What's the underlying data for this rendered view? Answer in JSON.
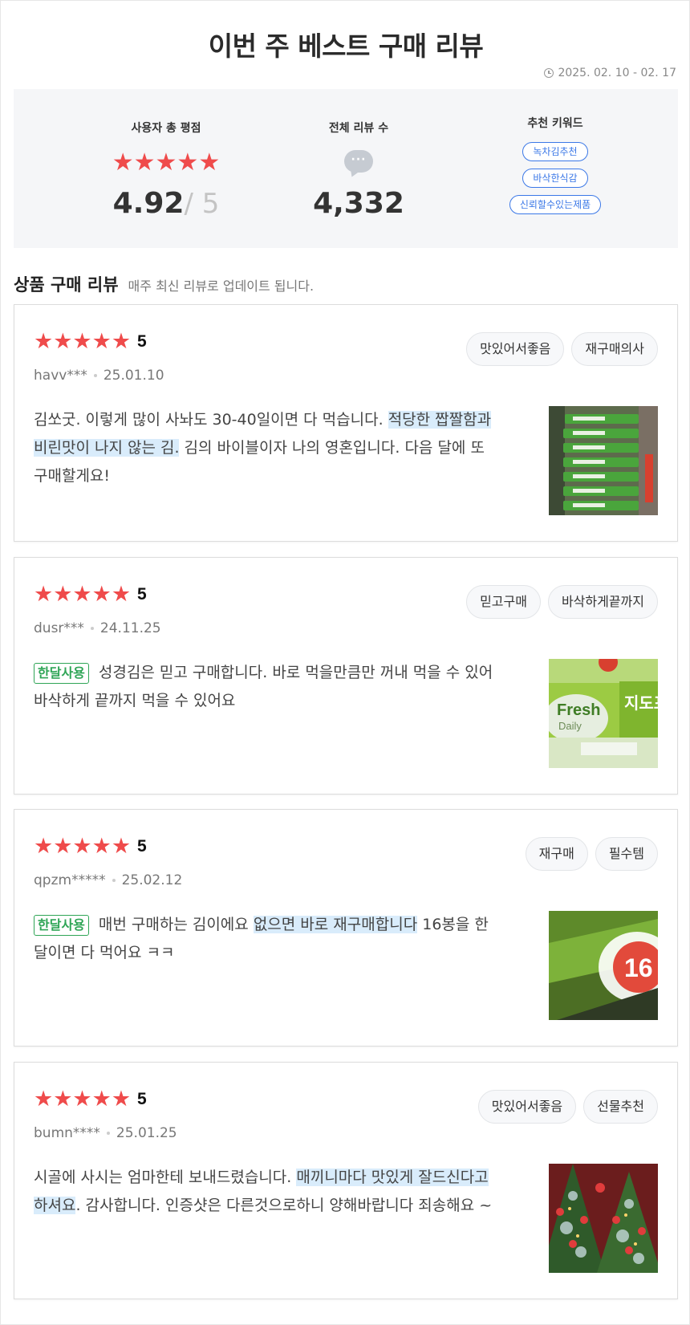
{
  "page": {
    "title": "이번 주 베스트 구매 리뷰",
    "date_range": "2025. 02. 10 - 02. 17"
  },
  "summary": {
    "rating_label": "사용자 총 평점",
    "stars": "★★★★★",
    "rating_value": "4.92",
    "rating_max": "/ 5",
    "reviews_label": "전체 리뷰 수",
    "chat_dots": "···",
    "review_count": "4,332",
    "keywords_label": "추천 키워드",
    "keywords": [
      "녹차김추천",
      "바삭한식감",
      "신뢰할수있는제품"
    ]
  },
  "section": {
    "title": "상품 구매 리뷰",
    "subtitle": "매주 최신 리뷰로 업데이트 됩니다."
  },
  "reviews": [
    {
      "stars": "★★★★★",
      "score": "5",
      "user": "havv***",
      "date": "25.01.10",
      "tags": [
        "맛있어서좋음",
        "재구매의사"
      ],
      "badge": "",
      "text_before": "김쏘굿. 이렇게 많이 사놔도 30-40일이면 다 먹습니다. ",
      "text_highlight": "적당한 짭짤함과 비린맛이 나지 않는 김.",
      "text_after": " 김의 바이블이자 나의 영혼입니다. 다음 달에 또 구매할게요!",
      "image": "green-seaweed-packs-photo"
    },
    {
      "stars": "★★★★★",
      "score": "5",
      "user": "dusr***",
      "date": "24.11.25",
      "tags": [
        "믿고구매",
        "바삭하게끝까지"
      ],
      "badge": "한달사용",
      "text_before": "성경김은 믿고 구매합니다. 바로 먹을만큼만 꺼내 먹을 수 있어 바삭하게 끝까지 먹을 수 있어요",
      "text_highlight": "",
      "text_after": "",
      "image": "fresh-daily-package-photo",
      "image_text_1": "Fresh",
      "image_text_2": "Daily",
      "image_text_3": "지도표"
    },
    {
      "stars": "★★★★★",
      "score": "5",
      "user": "qpzm*****",
      "date": "25.02.12",
      "tags": [
        "재구매",
        "필수템"
      ],
      "badge": "한달사용",
      "text_before": "매번 구매하는 김이에요 ",
      "text_highlight": "없으면 바로 재구매합니다",
      "text_after": " 16봉을 한 달이면 다 먹어요 ㅋㅋ",
      "image": "16-pack-label-photo",
      "image_text_1": "16"
    },
    {
      "stars": "★★★★★",
      "score": "5",
      "user": "bumn****",
      "date": "25.01.25",
      "tags": [
        "맛있어서좋음",
        "선물추천"
      ],
      "badge": "",
      "text_before": "시골에 사시는 엄마한테 보내드렸습니다. ",
      "text_highlight": "매끼니마다 맛있게 잘드신다고 하셔요",
      "text_after": ". 감사합니다. 인증샷은 다른것으로하니 양해바랍니다 죄송해요 ~",
      "image": "christmas-tree-photo"
    }
  ],
  "colors": {
    "star": "#ef4b4b",
    "keyword": "#3b78e7",
    "badge": "#2fa556",
    "highlight": "#d9ecfb"
  }
}
